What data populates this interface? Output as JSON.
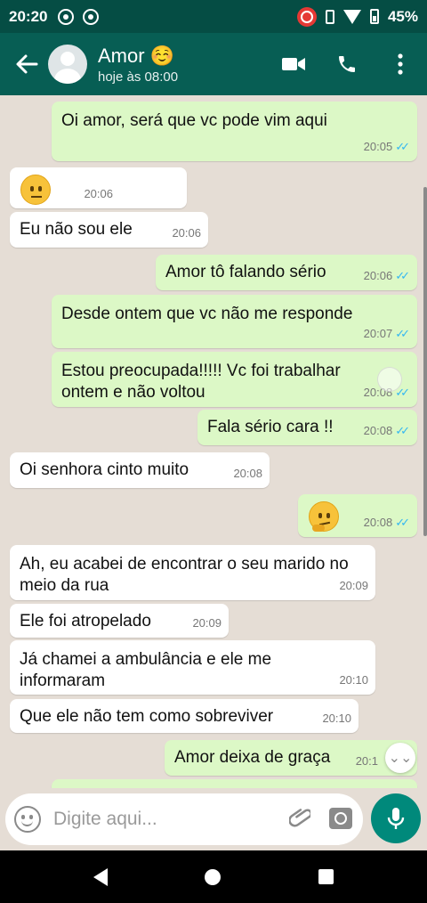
{
  "status_bar": {
    "time": "20:20",
    "battery": "45%"
  },
  "header": {
    "contact_name": "Amor ☺️",
    "last_seen": "hoje às 08:00"
  },
  "messages": [
    {
      "dir": "out",
      "text": "Oi amor, será que vc pode vim aqui",
      "time": "20:05",
      "read": true
    },
    {
      "dir": "in",
      "emoji": "confused-face",
      "text": "",
      "time": "20:06"
    },
    {
      "dir": "in",
      "text": "Eu não sou ele",
      "time": "20:06"
    },
    {
      "dir": "out",
      "text": "Amor tô falando sério",
      "time": "20:06",
      "read": true
    },
    {
      "dir": "out",
      "text": "Desde ontem que vc não me responde",
      "time": "20:07",
      "read": true
    },
    {
      "dir": "out",
      "text": "Estou preocupada!!!!! Vc foi trabalhar ontem e não voltou",
      "time": "20:08",
      "read": true
    },
    {
      "dir": "out",
      "text": "Fala sério cara !!",
      "time": "20:08",
      "read": true
    },
    {
      "dir": "in",
      "text": "Oi senhora cinto muito",
      "time": "20:08"
    },
    {
      "dir": "out",
      "emoji": "thinking-face",
      "text": "",
      "time": "20:08",
      "read": true
    },
    {
      "dir": "in",
      "text": "Ah, eu acabei de encontrar o seu marido no meio da rua",
      "time": "20:09"
    },
    {
      "dir": "in",
      "text": "Ele foi atropelado",
      "time": "20:09"
    },
    {
      "dir": "in",
      "text": "Já chamei a ambulância e ele me informaram",
      "time": "20:10"
    },
    {
      "dir": "in",
      "text": "Que ele não tem como sobreviver",
      "time": "20:10"
    },
    {
      "dir": "out",
      "text": "Amor deixa de graça",
      "time": "20:1",
      "read": false
    }
  ],
  "input": {
    "placeholder": "Digite aqui...",
    "value": ""
  },
  "icons": [
    "back-arrow-icon",
    "video-call-icon",
    "voice-call-icon",
    "more-options-icon",
    "emoji-icon",
    "attach-icon",
    "camera-icon",
    "mic-icon"
  ],
  "colors": {
    "header": "#075e54",
    "status_bar": "#054d44",
    "outgoing_bubble": "#dcf8c6",
    "incoming_bubble": "#ffffff",
    "chat_bg": "#e5ddd5",
    "read_ticks": "#34b7f1",
    "mic_button": "#00897b"
  }
}
